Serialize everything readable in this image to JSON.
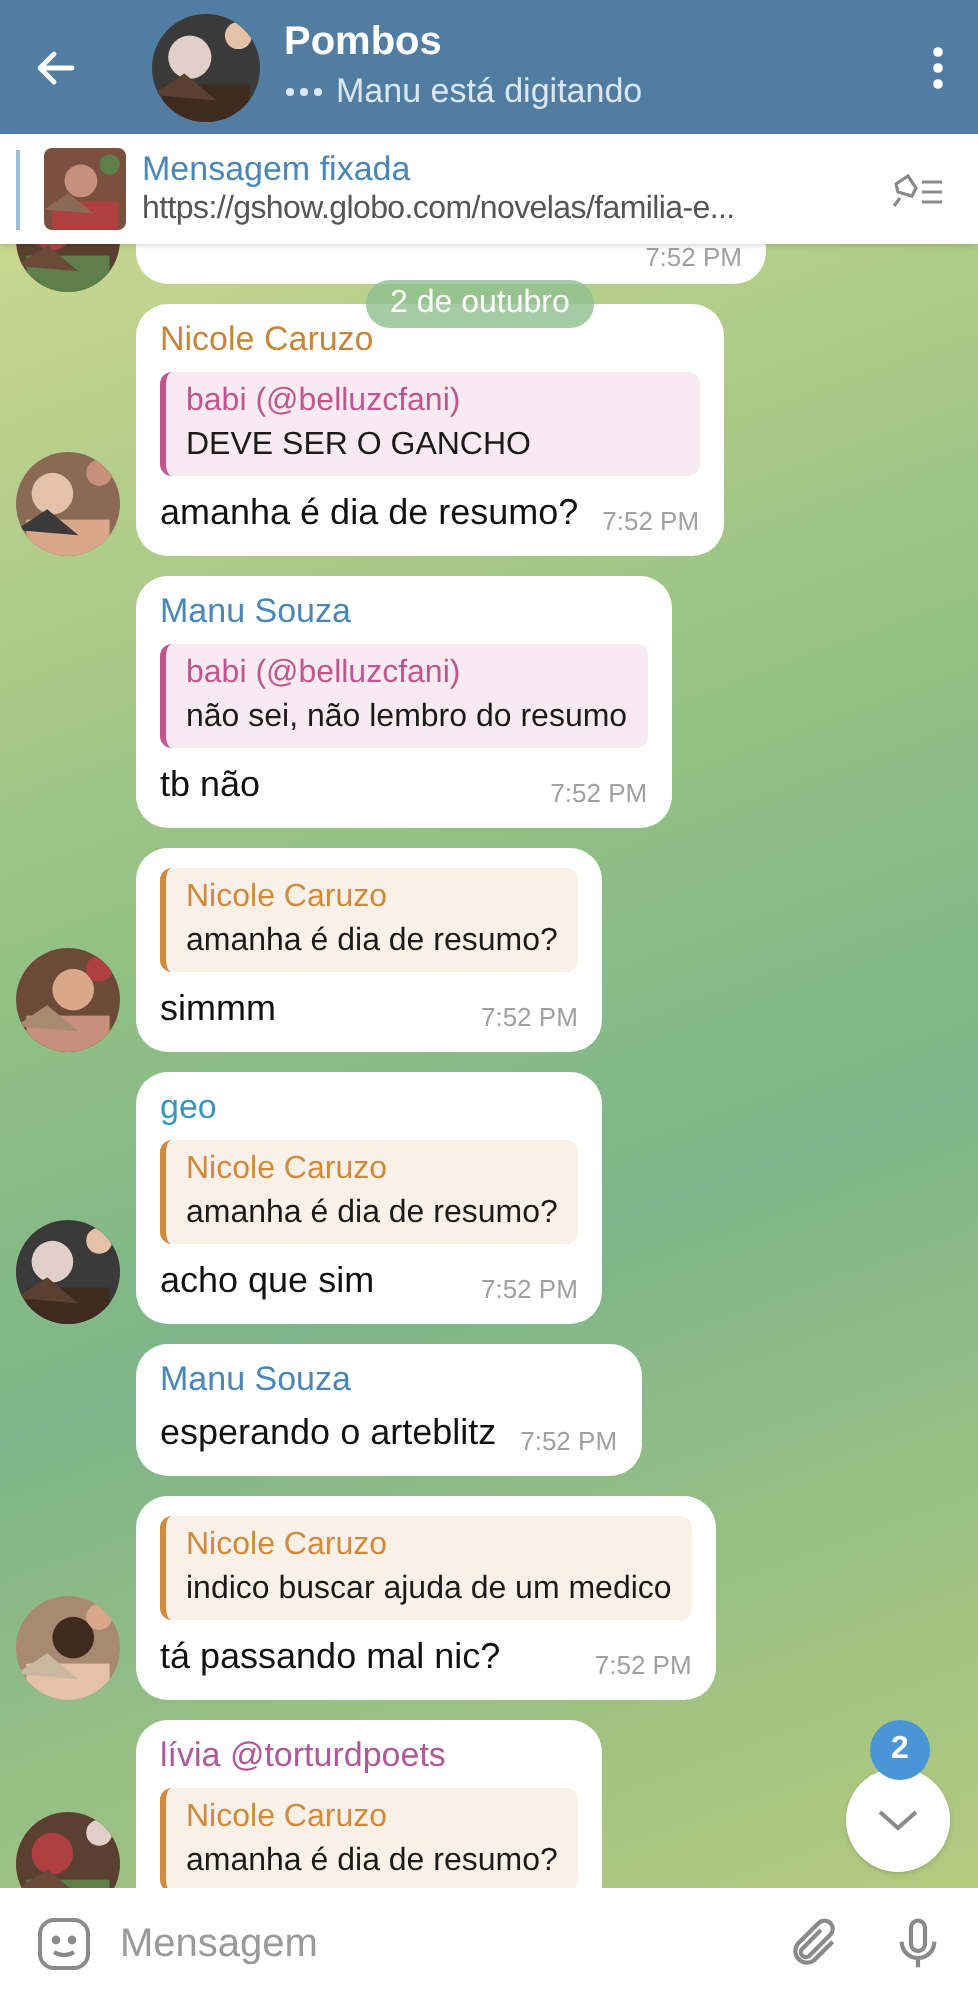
{
  "header": {
    "title": "Pombos",
    "status": "Manu está digitando"
  },
  "pinned": {
    "title": "Mensagem fixada",
    "text": "https://gshow.globo.com/novelas/familia-e..."
  },
  "partial_message": {
    "time": "7:52 PM"
  },
  "date_chip": "2 de outubro",
  "messages": [
    {
      "sender": "Nicole Caruzo",
      "color": "#c98537",
      "reply": {
        "author": "babi (@belluzcfani)",
        "text": "DEVE SER O GANCHO",
        "color": "#c0558f"
      },
      "text": "amanha é dia de resumo?",
      "time": "7:52 PM",
      "avatar": true
    },
    {
      "sender": "Manu Souza",
      "color": "#4a87b8",
      "reply": {
        "author": "babi (@belluzcfani)",
        "text": "não sei, não lembro do resumo",
        "color": "#c0558f"
      },
      "text": "tb não",
      "time": "7:52 PM",
      "avatar": false
    },
    {
      "text": "simmm",
      "time": "7:52 PM",
      "avatar": true,
      "reply": {
        "author": "Nicole Caruzo",
        "text": "amanha é dia de resumo?",
        "color": "#d08a3b"
      }
    },
    {
      "sender": "geo",
      "color": "#3a95c0",
      "reply": {
        "author": "Nicole Caruzo",
        "text": "amanha é dia de resumo?",
        "color": "#d08a3b"
      },
      "text": "acho que sim",
      "time": "7:52 PM",
      "avatar": true
    },
    {
      "sender": "Manu Souza",
      "color": "#4a87b8",
      "text": "esperando o arteblitz",
      "time": "7:52 PM",
      "avatar": false
    },
    {
      "reply": {
        "author": "Nicole Caruzo",
        "text": "indico buscar ajuda de um medico",
        "color": "#d08a3b"
      },
      "text": "tá passando mal nic?",
      "time": "7:52 PM",
      "avatar": true
    },
    {
      "sender": "lívia @torturdpoets",
      "color": "#b0589a",
      "reply": {
        "author": "Nicole Caruzo",
        "text": "amanha é dia de resumo?",
        "color": "#d08a3b"
      },
      "avatar": true
    }
  ],
  "scroll_button": {
    "badge": "2"
  },
  "composer": {
    "placeholder": "Mensagem"
  }
}
